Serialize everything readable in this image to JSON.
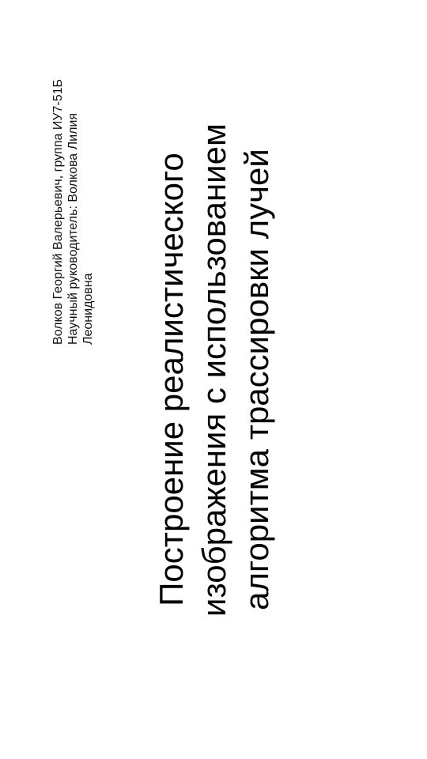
{
  "slide": {
    "title_lines": [
      "Построение реалистического",
      "изображения с использованием",
      "алгоритма трассировки лучей"
    ],
    "author_lines": [
      "Волков Георгий Валерьевич, группа ИУ7-51Б",
      "Научный руководитель: Волкова Лилия",
      "Леонидовна"
    ]
  }
}
